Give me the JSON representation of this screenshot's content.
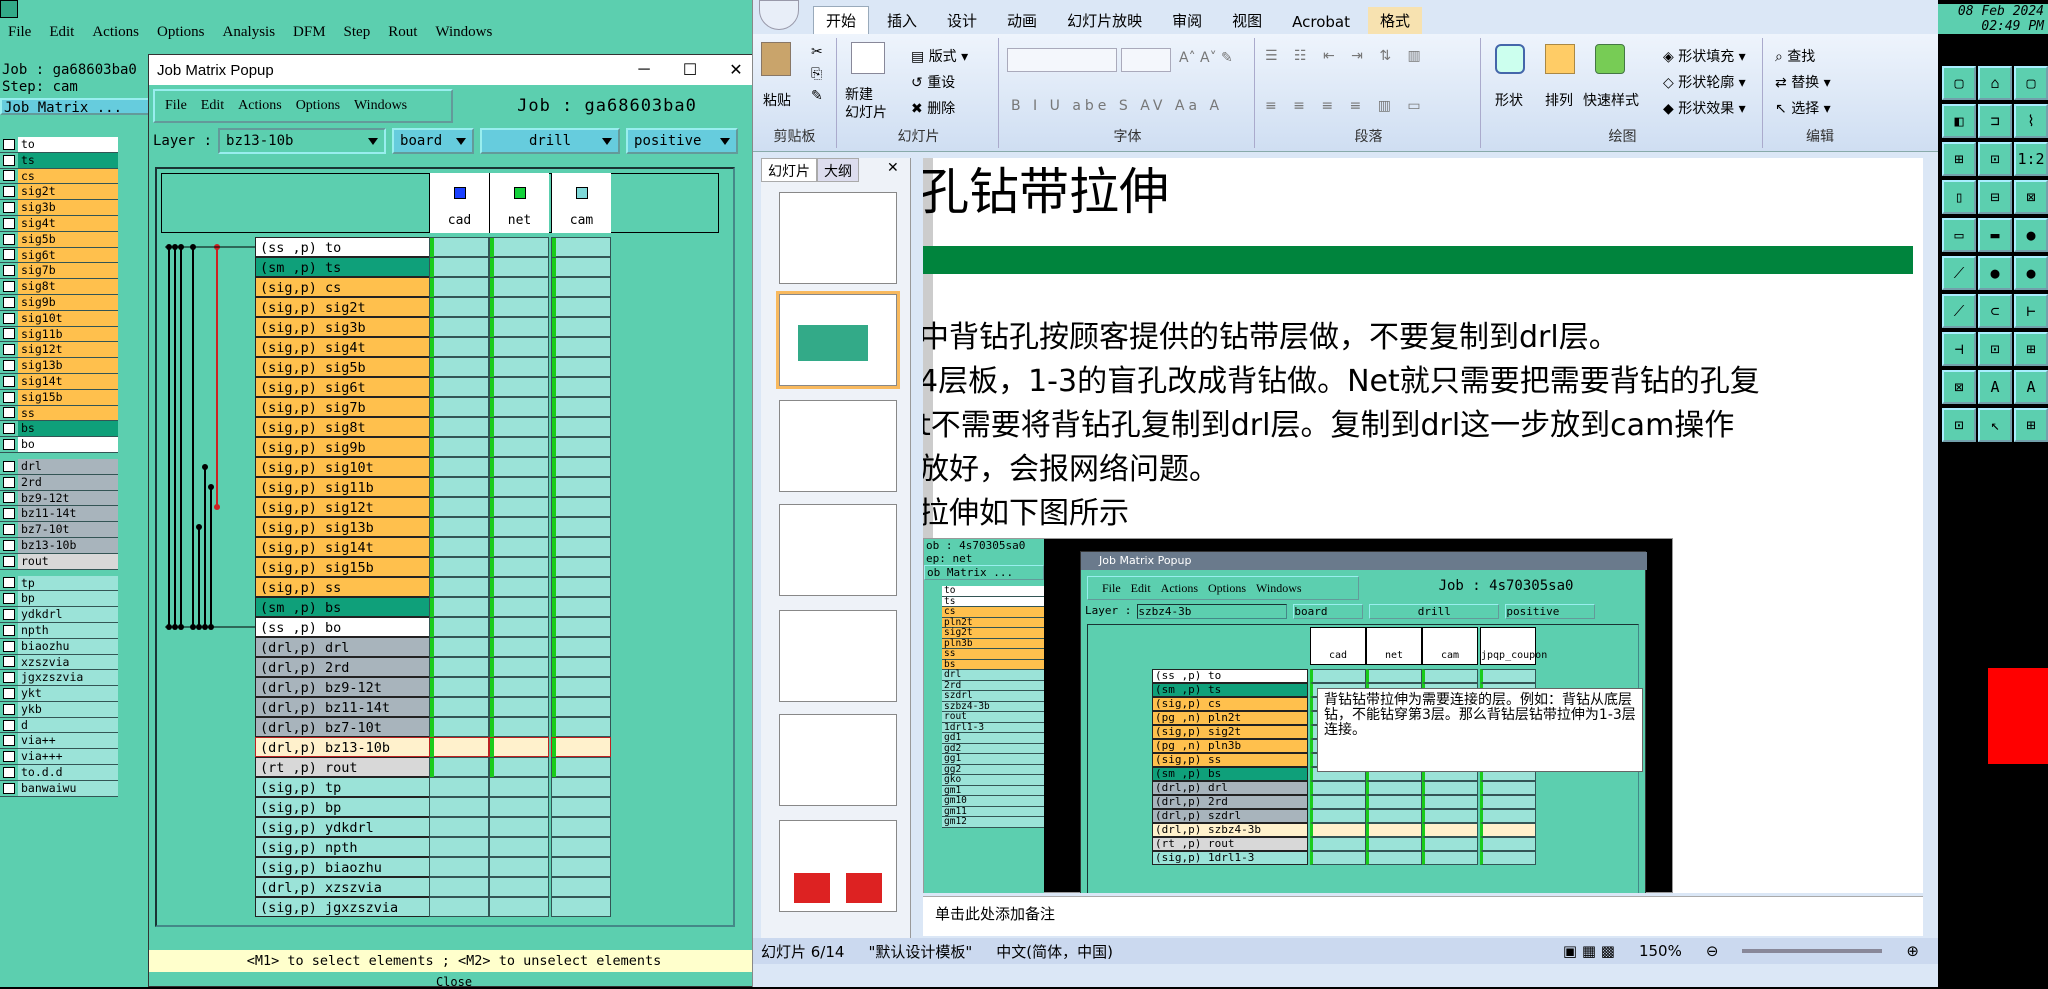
{
  "genesis": {
    "menu": [
      "File",
      "Edit",
      "Actions",
      "Options",
      "Analysis",
      "DFM",
      "Step",
      "Rout",
      "Windows"
    ],
    "job_line": "Job : ga68603ba0",
    "step_line": "Step: cam",
    "job_matrix_btn": "Job Matrix ...",
    "left_layers_a": [
      "to",
      "ts",
      "cs",
      "sig2t",
      "sig3b",
      "sig4t",
      "sig5b",
      "sig6t",
      "sig7b",
      "sig8t",
      "sig9b",
      "sig10t",
      "sig11b",
      "sig12t",
      "sig13b",
      "sig14t",
      "sig15b",
      "ss",
      "bs",
      "bo"
    ],
    "left_layers_b": [
      "drl",
      "2rd",
      "bz9-12t",
      "bz11-14t",
      "bz7-10t",
      "bz13-10b",
      "rout"
    ],
    "left_layers_c": [
      "tp",
      "bp",
      "ydkdrl",
      "npth",
      "biaozhu",
      "xzszvia",
      "jgxzszvia",
      "ykt",
      "ykb",
      "d",
      "via++",
      "via+++",
      "to.d.d",
      "banwaiwu"
    ]
  },
  "popup": {
    "title": "Job Matrix Popup",
    "menu": [
      "File",
      "Edit",
      "Actions",
      "Options",
      "Windows"
    ],
    "job": "Job : ga68603ba0",
    "layer_label": "Layer :",
    "layer_value": "bz13-10b",
    "sel_board": "board",
    "sel_drill": "drill",
    "sel_positive": "positive",
    "cols": [
      "cad",
      "net",
      "cam"
    ],
    "rows": [
      {
        "t": "(ss ,p) to",
        "c": "white"
      },
      {
        "t": "(sm ,p) ts",
        "c": "teal"
      },
      {
        "t": "(sig,p) cs",
        "c": "orange"
      },
      {
        "t": "(sig,p) sig2t",
        "c": "orange"
      },
      {
        "t": "(sig,p) sig3b",
        "c": "orange"
      },
      {
        "t": "(sig,p) sig4t",
        "c": "orange"
      },
      {
        "t": "(sig,p) sig5b",
        "c": "orange"
      },
      {
        "t": "(sig,p) sig6t",
        "c": "orange"
      },
      {
        "t": "(sig,p) sig7b",
        "c": "orange"
      },
      {
        "t": "(sig,p) sig8t",
        "c": "orange"
      },
      {
        "t": "(sig,p) sig9b",
        "c": "orange"
      },
      {
        "t": "(sig,p) sig10t",
        "c": "orange"
      },
      {
        "t": "(sig,p) sig11b",
        "c": "orange"
      },
      {
        "t": "(sig,p) sig12t",
        "c": "orange"
      },
      {
        "t": "(sig,p) sig13b",
        "c": "orange"
      },
      {
        "t": "(sig,p) sig14t",
        "c": "orange"
      },
      {
        "t": "(sig,p) sig15b",
        "c": "orange"
      },
      {
        "t": "(sig,p) ss",
        "c": "orange"
      },
      {
        "t": "(sm ,p) bs",
        "c": "teal"
      },
      {
        "t": "(ss ,p) bo",
        "c": "white"
      },
      {
        "t": "(drl,p) drl",
        "c": "grey"
      },
      {
        "t": "(drl,p) 2rd",
        "c": "grey"
      },
      {
        "t": "(drl,p) bz9-12t",
        "c": "grey"
      },
      {
        "t": "(drl,p) bz11-14t",
        "c": "grey"
      },
      {
        "t": "(drl,p) bz7-10t",
        "c": "grey"
      },
      {
        "t": "(drl,p) bz13-10b",
        "c": "sel"
      },
      {
        "t": "(rt ,p) rout",
        "c": "lgrey"
      },
      {
        "t": "(sig,p) tp",
        "c": "lteal"
      },
      {
        "t": "(sig,p) bp",
        "c": "lteal"
      },
      {
        "t": "(sig,p) ydkdrl",
        "c": "lteal"
      },
      {
        "t": "(sig,p) npth",
        "c": "lteal"
      },
      {
        "t": "(sig,p) biaozhu",
        "c": "lteal"
      },
      {
        "t": "(drl,p) xzszvia",
        "c": "lteal"
      },
      {
        "t": "(sig,p) jgxzszvia",
        "c": "lteal"
      }
    ],
    "status": "<M1> to select elements ; <M2> to unselect elements",
    "close": "Close"
  },
  "ppt": {
    "tabs": [
      "开始",
      "插入",
      "设计",
      "动画",
      "幻灯片放映",
      "审阅",
      "视图",
      "Acrobat",
      "格式"
    ],
    "groups": {
      "clipboard": "剪贴板",
      "slides": "幻灯片",
      "font": "字体",
      "paragraph": "段落",
      "drawing": "绘图",
      "editing": "编辑"
    },
    "buttons": {
      "paste": "粘贴",
      "new_slide": "新建\n幻灯片",
      "layout": "版式",
      "reset": "重设",
      "delete": "删除",
      "shape": "形状",
      "arrange": "排列",
      "quick_style": "快速样式",
      "fill": "形状填充",
      "outline": "形状轮廓",
      "effect": "形状效果",
      "find": "查找",
      "replace": "替换",
      "select": "选择"
    },
    "panel_tabs": [
      "幻灯片",
      "大纲"
    ],
    "slide_title": "孔钻带拉伸",
    "slide_lines": [
      "中背钻孔按顾客提供的钻带层做，不要复制到drl层。",
      "4层板，1-3的盲孔改成背钻做。Net就只需要把需要背钻的孔复",
      "t不需要将背钻孔复制到drl层。复制到drl这一步放到cam操作",
      "放好，会报网络问题。",
      "拉伸如下图所示"
    ],
    "inner": {
      "title": "Job Matrix Popup",
      "job": "Job : 4s70305sa0",
      "left_job": "ob : 4s70305sa0",
      "left_step": "ep: net",
      "left_btn": "ob Matrix ...",
      "menu": [
        "File",
        "Edit",
        "Actions",
        "Options",
        "Windows"
      ],
      "layer": "szbz4-3b",
      "board": "board",
      "drill": "drill",
      "positive": "positive",
      "cols": [
        "cad",
        "net",
        "cam",
        "jpqp_coupon"
      ],
      "rows": [
        "(ss ,p) to",
        "(sm ,p) ts",
        "(sig,p) cs",
        "(pg ,n) pln2t",
        "(sig,p) sig2t",
        "(pg ,n) pln3b",
        "(sig,p) ss",
        "(sm ,p) bs",
        "(drl,p) drl",
        "(drl,p) 2rd",
        "(drl,p) szdrl",
        "(drl,p) szbz4-3b",
        "(rt ,p) rout",
        "(sig,p) 1drl1-3"
      ],
      "left_list": [
        "to",
        "ts",
        "cs",
        "pln2t",
        "sig2t",
        "pln3b",
        "ss",
        "bs",
        "drl",
        "2rd",
        "szdrl",
        "szbz4-3b",
        "rout",
        "1drl1-3",
        "gd1",
        "gd2",
        "gg1",
        "gg2",
        "gko",
        "gm1",
        "gm10",
        "gm11",
        "gm12"
      ],
      "note": "背钻钻带拉伸为需要连接的层。例如：背钻从底层钻，不能钻穿第3层。那么背钻层钻带拉伸为1-3层连接。"
    },
    "notes": "单击此处添加备注",
    "status_slide": "幻灯片 6/14",
    "status_theme": "\"默认设计模板\"",
    "status_lang": "中文(简体，中国)",
    "zoom": "150%"
  },
  "tools": {
    "clock1": "08 Feb 2024",
    "clock2": "02:49 PM"
  }
}
